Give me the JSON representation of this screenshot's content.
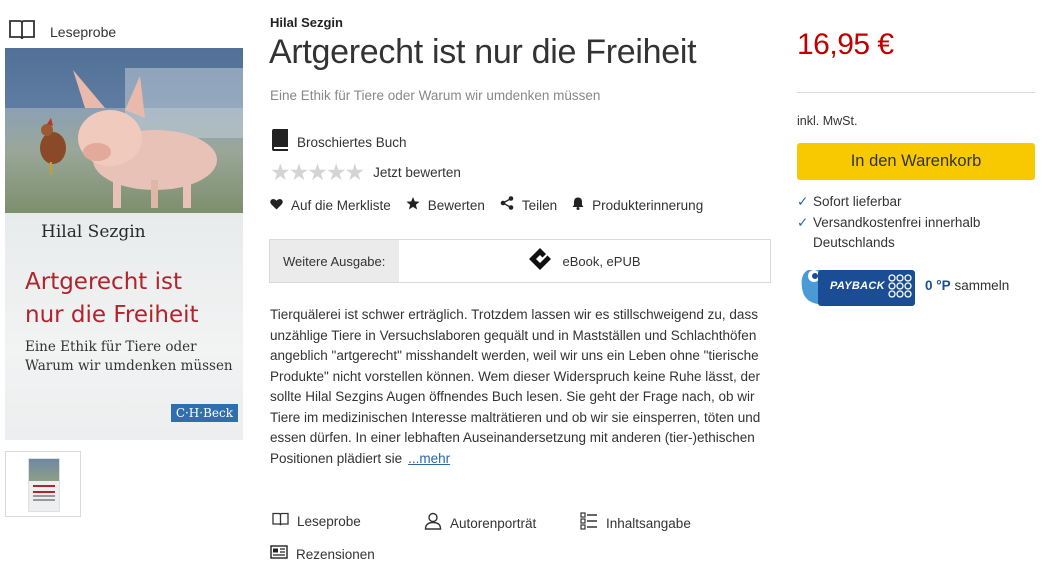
{
  "leseprobe_top": {
    "label": "Leseprobe",
    "icon": "book-open-icon"
  },
  "cover": {
    "author": "Hilal Sezgin",
    "title": "Artgerecht ist\nnur die Freiheit",
    "subtitle": "Eine Ethik für Tiere oder\nWarum wir umdenken müssen",
    "publisher": "C·H·Beck"
  },
  "product": {
    "author": "Hilal Sezgin",
    "title": "Artgerecht ist nur die Freiheit",
    "subtitle": "Eine Ethik für Tiere oder Warum wir umdenken müssen",
    "format": "Broschiertes Buch",
    "rating_label": "Jetzt bewerten",
    "rating_stars": 0
  },
  "actions": [
    {
      "label": "Auf die Merkliste",
      "icon": "heart-icon"
    },
    {
      "label": "Bewerten",
      "icon": "star-icon"
    },
    {
      "label": "Teilen",
      "icon": "share-icon"
    },
    {
      "label": "Produkterinnerung",
      "icon": "bell-icon"
    }
  ],
  "edition": {
    "label": "Weitere Ausgabe:",
    "value": "eBook, ePUB",
    "icon": "epub-icon"
  },
  "description": {
    "text": "Tierquälerei ist schwer erträglich. Trotzdem lassen wir es stillschweigend zu, dass unzählige Tiere in Versuchslaboren gequält und in Mastställen und Schlachthöfen angeblich \"artgerecht\" misshandelt werden, weil wir uns ein Leben ohne \"tierische Produkte\" nicht vorstellen können. Wem dieser Widerspruch keine Ruhe lässt, der sollte Hilal Sezgins Augen öffnendes Buch lesen. Sie geht der Frage nach, ob wir Tiere im medizinischen Interesse malträtieren und ob wir sie einsperren, töten und essen dürfen. In einer lebhaften Auseinandersetzung mit anderen (tier-)ethischen Positionen plädiert sie",
    "more": "...mehr"
  },
  "bottom_links": {
    "leseprobe": "Leseprobe",
    "autorenportraet": "Autorenporträt",
    "inhaltsangabe": "Inhaltsangabe",
    "rezensionen": "Rezensionen"
  },
  "buy": {
    "price": "16,95 €",
    "vat": "inkl. MwSt.",
    "cart_button": "In den Warenkorb",
    "delivery": [
      "Sofort lieferbar",
      "Versandkostenfrei innerhalb",
      "Deutschlands"
    ],
    "check_mark": "✓",
    "payback_logo": "PAYBACK",
    "payback_points": "0 °P",
    "payback_suffix": "sammeln"
  },
  "colors": {
    "price": "#c00000",
    "cart_button": "#f8c800",
    "link": "#2b66a6",
    "payback": "#1a4d94"
  }
}
